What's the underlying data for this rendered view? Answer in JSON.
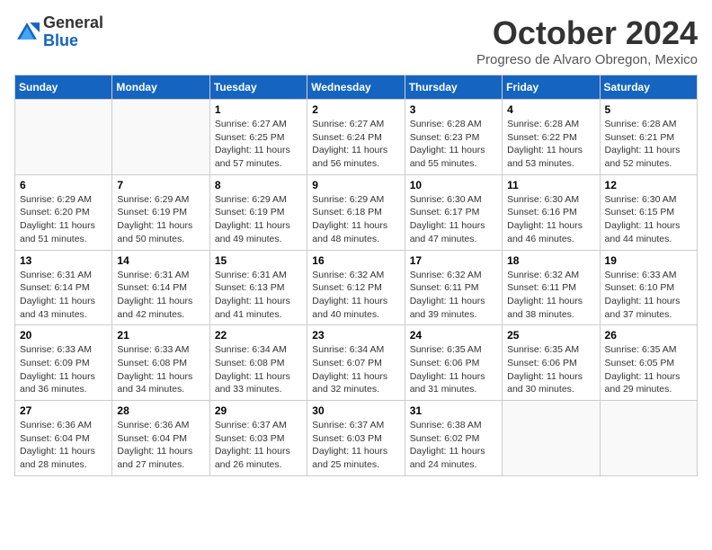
{
  "header": {
    "logo_general": "General",
    "logo_blue": "Blue",
    "month_title": "October 2024",
    "subtitle": "Progreso de Alvaro Obregon, Mexico"
  },
  "weekdays": [
    "Sunday",
    "Monday",
    "Tuesday",
    "Wednesday",
    "Thursday",
    "Friday",
    "Saturday"
  ],
  "weeks": [
    [
      {
        "day": "",
        "info": ""
      },
      {
        "day": "",
        "info": ""
      },
      {
        "day": "1",
        "info": "Sunrise: 6:27 AM\nSunset: 6:25 PM\nDaylight: 11 hours and 57 minutes."
      },
      {
        "day": "2",
        "info": "Sunrise: 6:27 AM\nSunset: 6:24 PM\nDaylight: 11 hours and 56 minutes."
      },
      {
        "day": "3",
        "info": "Sunrise: 6:28 AM\nSunset: 6:23 PM\nDaylight: 11 hours and 55 minutes."
      },
      {
        "day": "4",
        "info": "Sunrise: 6:28 AM\nSunset: 6:22 PM\nDaylight: 11 hours and 53 minutes."
      },
      {
        "day": "5",
        "info": "Sunrise: 6:28 AM\nSunset: 6:21 PM\nDaylight: 11 hours and 52 minutes."
      }
    ],
    [
      {
        "day": "6",
        "info": "Sunrise: 6:29 AM\nSunset: 6:20 PM\nDaylight: 11 hours and 51 minutes."
      },
      {
        "day": "7",
        "info": "Sunrise: 6:29 AM\nSunset: 6:19 PM\nDaylight: 11 hours and 50 minutes."
      },
      {
        "day": "8",
        "info": "Sunrise: 6:29 AM\nSunset: 6:19 PM\nDaylight: 11 hours and 49 minutes."
      },
      {
        "day": "9",
        "info": "Sunrise: 6:29 AM\nSunset: 6:18 PM\nDaylight: 11 hours and 48 minutes."
      },
      {
        "day": "10",
        "info": "Sunrise: 6:30 AM\nSunset: 6:17 PM\nDaylight: 11 hours and 47 minutes."
      },
      {
        "day": "11",
        "info": "Sunrise: 6:30 AM\nSunset: 6:16 PM\nDaylight: 11 hours and 46 minutes."
      },
      {
        "day": "12",
        "info": "Sunrise: 6:30 AM\nSunset: 6:15 PM\nDaylight: 11 hours and 44 minutes."
      }
    ],
    [
      {
        "day": "13",
        "info": "Sunrise: 6:31 AM\nSunset: 6:14 PM\nDaylight: 11 hours and 43 minutes."
      },
      {
        "day": "14",
        "info": "Sunrise: 6:31 AM\nSunset: 6:14 PM\nDaylight: 11 hours and 42 minutes."
      },
      {
        "day": "15",
        "info": "Sunrise: 6:31 AM\nSunset: 6:13 PM\nDaylight: 11 hours and 41 minutes."
      },
      {
        "day": "16",
        "info": "Sunrise: 6:32 AM\nSunset: 6:12 PM\nDaylight: 11 hours and 40 minutes."
      },
      {
        "day": "17",
        "info": "Sunrise: 6:32 AM\nSunset: 6:11 PM\nDaylight: 11 hours and 39 minutes."
      },
      {
        "day": "18",
        "info": "Sunrise: 6:32 AM\nSunset: 6:11 PM\nDaylight: 11 hours and 38 minutes."
      },
      {
        "day": "19",
        "info": "Sunrise: 6:33 AM\nSunset: 6:10 PM\nDaylight: 11 hours and 37 minutes."
      }
    ],
    [
      {
        "day": "20",
        "info": "Sunrise: 6:33 AM\nSunset: 6:09 PM\nDaylight: 11 hours and 36 minutes."
      },
      {
        "day": "21",
        "info": "Sunrise: 6:33 AM\nSunset: 6:08 PM\nDaylight: 11 hours and 34 minutes."
      },
      {
        "day": "22",
        "info": "Sunrise: 6:34 AM\nSunset: 6:08 PM\nDaylight: 11 hours and 33 minutes."
      },
      {
        "day": "23",
        "info": "Sunrise: 6:34 AM\nSunset: 6:07 PM\nDaylight: 11 hours and 32 minutes."
      },
      {
        "day": "24",
        "info": "Sunrise: 6:35 AM\nSunset: 6:06 PM\nDaylight: 11 hours and 31 minutes."
      },
      {
        "day": "25",
        "info": "Sunrise: 6:35 AM\nSunset: 6:06 PM\nDaylight: 11 hours and 30 minutes."
      },
      {
        "day": "26",
        "info": "Sunrise: 6:35 AM\nSunset: 6:05 PM\nDaylight: 11 hours and 29 minutes."
      }
    ],
    [
      {
        "day": "27",
        "info": "Sunrise: 6:36 AM\nSunset: 6:04 PM\nDaylight: 11 hours and 28 minutes."
      },
      {
        "day": "28",
        "info": "Sunrise: 6:36 AM\nSunset: 6:04 PM\nDaylight: 11 hours and 27 minutes."
      },
      {
        "day": "29",
        "info": "Sunrise: 6:37 AM\nSunset: 6:03 PM\nDaylight: 11 hours and 26 minutes."
      },
      {
        "day": "30",
        "info": "Sunrise: 6:37 AM\nSunset: 6:03 PM\nDaylight: 11 hours and 25 minutes."
      },
      {
        "day": "31",
        "info": "Sunrise: 6:38 AM\nSunset: 6:02 PM\nDaylight: 11 hours and 24 minutes."
      },
      {
        "day": "",
        "info": ""
      },
      {
        "day": "",
        "info": ""
      }
    ]
  ]
}
